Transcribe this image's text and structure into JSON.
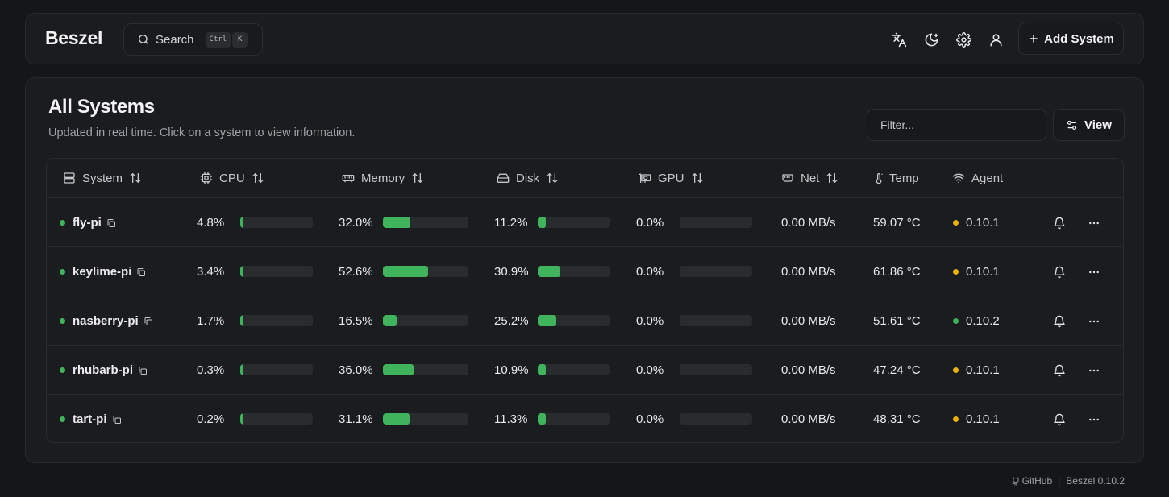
{
  "header": {
    "logo": "Beszel",
    "search": {
      "label": "Search",
      "kbd_ctrl": "Ctrl",
      "kbd_key": "K"
    },
    "icons": [
      "languages-icon",
      "moon-icon",
      "gear-icon",
      "user-icon"
    ],
    "add_system_label": "Add System"
  },
  "card": {
    "title": "All Systems",
    "subtitle": "Updated in real time. Click on a system to view information.",
    "filter_placeholder": "Filter...",
    "view_label": "View"
  },
  "table": {
    "columns": {
      "system": "System",
      "cpu": "CPU",
      "memory": "Memory",
      "disk": "Disk",
      "gpu": "GPU",
      "net": "Net",
      "temp": "Temp",
      "agent": "Agent"
    },
    "rows": [
      {
        "name": "fly-pi",
        "cpu": "4.8%",
        "cpu_value": 4.8,
        "memory": "32.0%",
        "memory_value": 32.0,
        "disk": "11.2%",
        "disk_value": 11.2,
        "gpu": "0.0%",
        "gpu_value": 0.0,
        "net": "0.00 MB/s",
        "temp": "59.07 °C",
        "agent": "0.10.1",
        "agent_status": "warning"
      },
      {
        "name": "keylime-pi",
        "cpu": "3.4%",
        "cpu_value": 3.4,
        "memory": "52.6%",
        "memory_value": 52.6,
        "disk": "30.9%",
        "disk_value": 30.9,
        "gpu": "0.0%",
        "gpu_value": 0.0,
        "net": "0.00 MB/s",
        "temp": "61.86 °C",
        "agent": "0.10.1",
        "agent_status": "warning"
      },
      {
        "name": "nasberry-pi",
        "cpu": "1.7%",
        "cpu_value": 1.7,
        "memory": "16.5%",
        "memory_value": 16.5,
        "disk": "25.2%",
        "disk_value": 25.2,
        "gpu": "0.0%",
        "gpu_value": 0.0,
        "net": "0.00 MB/s",
        "temp": "51.61 °C",
        "agent": "0.10.2",
        "agent_status": "ok"
      },
      {
        "name": "rhubarb-pi",
        "cpu": "0.3%",
        "cpu_value": 0.3,
        "memory": "36.0%",
        "memory_value": 36.0,
        "disk": "10.9%",
        "disk_value": 10.9,
        "gpu": "0.0%",
        "gpu_value": 0.0,
        "net": "0.00 MB/s",
        "temp": "47.24 °C",
        "agent": "0.10.1",
        "agent_status": "warning"
      },
      {
        "name": "tart-pi",
        "cpu": "0.2%",
        "cpu_value": 0.2,
        "memory": "31.1%",
        "memory_value": 31.1,
        "disk": "11.3%",
        "disk_value": 11.3,
        "gpu": "0.0%",
        "gpu_value": 0.0,
        "net": "0.00 MB/s",
        "temp": "48.31 °C",
        "agent": "0.10.1",
        "agent_status": "warning"
      }
    ]
  },
  "footer": {
    "github": "GitHub",
    "version": "Beszel 0.10.2"
  },
  "colors": {
    "online": "#3fb45d",
    "warning": "#eab308",
    "bar_fill": "#3fb45d",
    "bar_track": "#2a2b2f"
  }
}
